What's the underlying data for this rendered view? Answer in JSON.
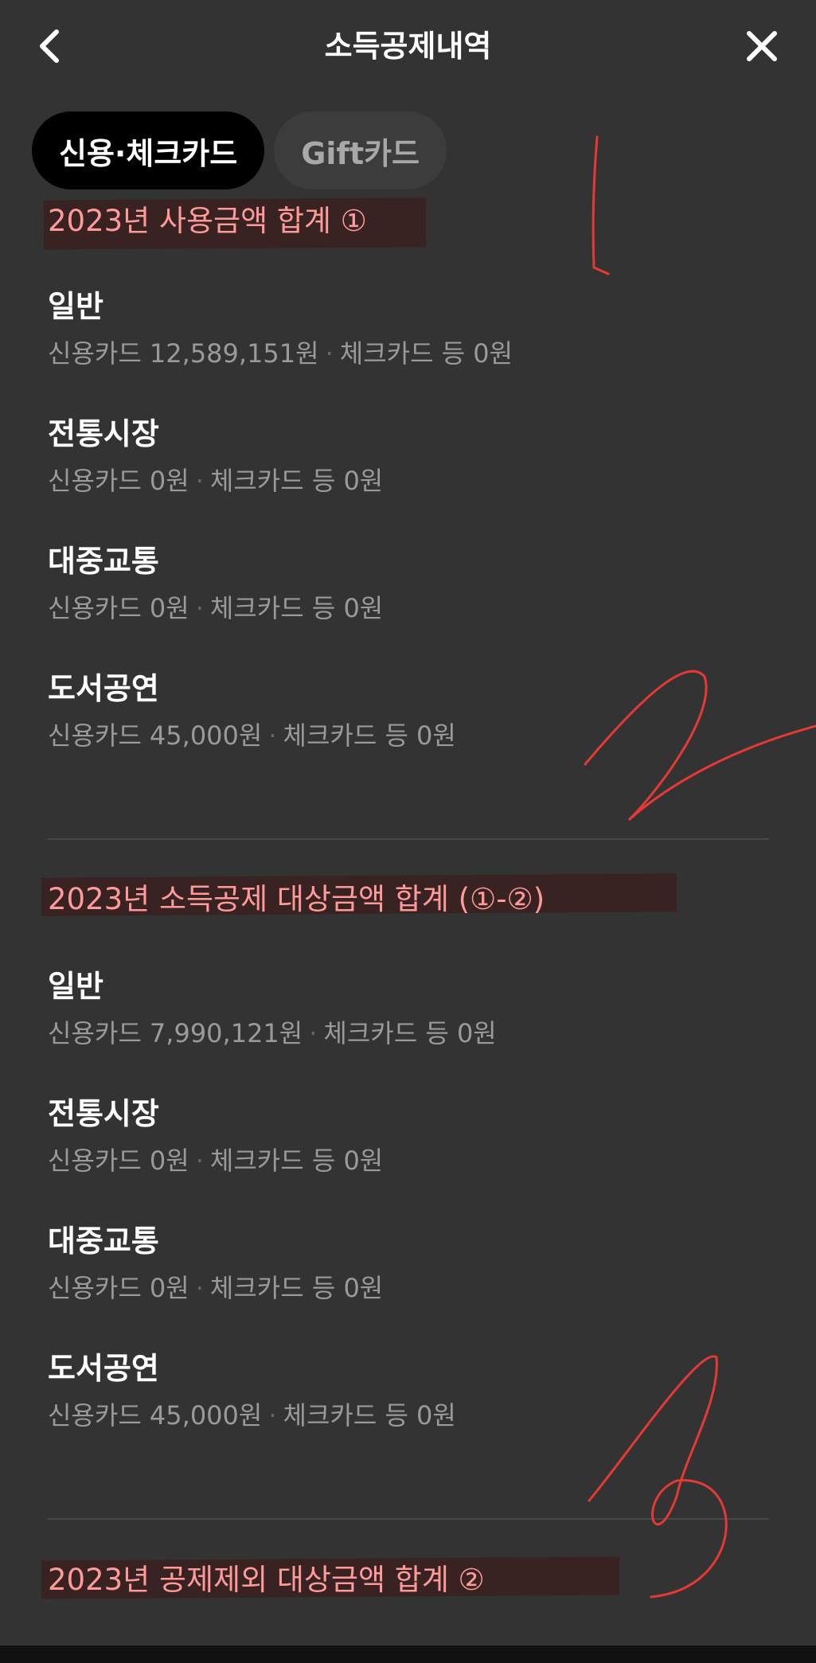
{
  "header": {
    "title": "소득공제내역",
    "back_icon": "chevron-left-icon",
    "close_icon": "close-icon"
  },
  "tabs": [
    {
      "label": "신용·체크카드",
      "active": true
    },
    {
      "label": "Gift카드",
      "active": false
    }
  ],
  "sections": [
    {
      "title": "2023년 사용금액 합계 ①",
      "items": [
        {
          "label": "일반",
          "credit": "신용카드 12,589,151원",
          "check": "체크카드 등 0원"
        },
        {
          "label": "전통시장",
          "credit": "신용카드 0원",
          "check": "체크카드 등 0원"
        },
        {
          "label": "대중교통",
          "credit": "신용카드 0원",
          "check": "체크카드 등 0원"
        },
        {
          "label": "도서공연",
          "credit": "신용카드 45,000원",
          "check": "체크카드 등 0원"
        }
      ]
    },
    {
      "title": "2023년 소득공제 대상금액 합계 (①-②)",
      "items": [
        {
          "label": "일반",
          "credit": "신용카드 7,990,121원",
          "check": "체크카드 등 0원"
        },
        {
          "label": "전통시장",
          "credit": "신용카드 0원",
          "check": "체크카드 등 0원"
        },
        {
          "label": "대중교통",
          "credit": "신용카드 0원",
          "check": "체크카드 등 0원"
        },
        {
          "label": "도서공연",
          "credit": "신용카드 45,000원",
          "check": "체크카드 등 0원"
        }
      ]
    },
    {
      "title": "2023년 공제제외 대상금액 합계 ②",
      "items": []
    }
  ],
  "colors": {
    "background": "#333333",
    "section_title": "#ff9a9a",
    "detail_text": "#9a9a9a",
    "annotation": "#e53935"
  }
}
